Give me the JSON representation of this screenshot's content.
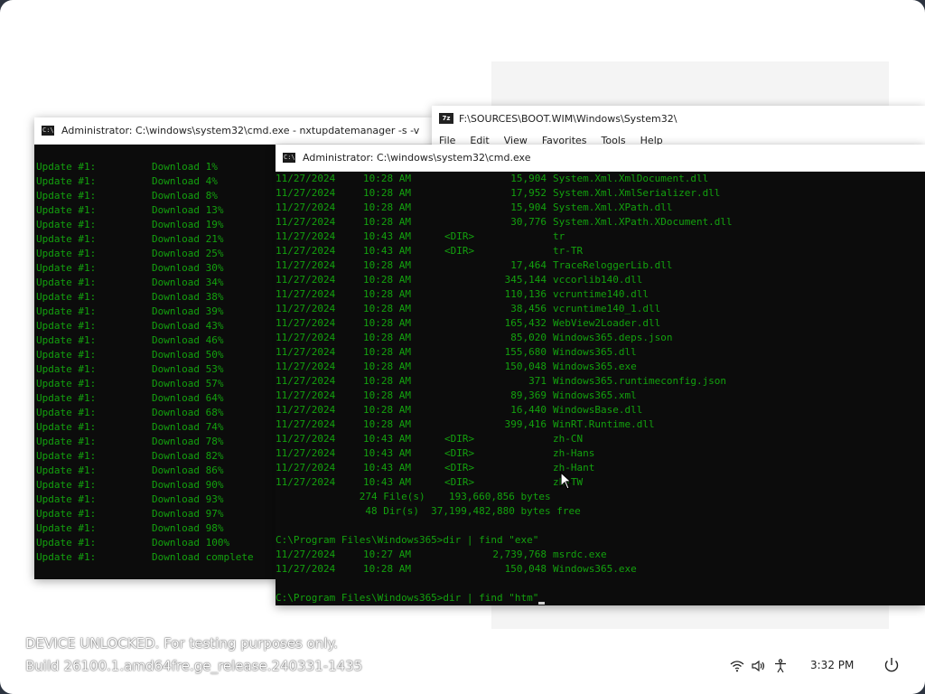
{
  "watermark": {
    "line1": "DEVICE UNLOCKED. For testing purposes only.",
    "line2": "Build 26100.1.amd64fre.ge_release.240331-1435"
  },
  "tray": {
    "icons": [
      "wifi-icon",
      "volume-icon",
      "accessibility-icon"
    ],
    "clock": "3:32 PM",
    "power_icon": "power-icon"
  },
  "window_update": {
    "title": "Administrator: C:\\windows\\system32\\cmd.exe - nxtupdatemanager  -s -v",
    "lines": [
      [
        "Update #1:",
        "Download 1%"
      ],
      [
        "Update #1:",
        "Download 4%"
      ],
      [
        "Update #1:",
        "Download 8%"
      ],
      [
        "Update #1:",
        "Download 13%"
      ],
      [
        "Update #1:",
        "Download 19%"
      ],
      [
        "Update #1:",
        "Download 21%"
      ],
      [
        "Update #1:",
        "Download 25%"
      ],
      [
        "Update #1:",
        "Download 30%"
      ],
      [
        "Update #1:",
        "Download 34%"
      ],
      [
        "Update #1:",
        "Download 38%"
      ],
      [
        "Update #1:",
        "Download 39%"
      ],
      [
        "Update #1:",
        "Download 43%"
      ],
      [
        "Update #1:",
        "Download 46%"
      ],
      [
        "Update #1:",
        "Download 50%"
      ],
      [
        "Update #1:",
        "Download 53%"
      ],
      [
        "Update #1:",
        "Download 57%"
      ],
      [
        "Update #1:",
        "Download 64%"
      ],
      [
        "Update #1:",
        "Download 68%"
      ],
      [
        "Update #1:",
        "Download 74%"
      ],
      [
        "Update #1:",
        "Download 78%"
      ],
      [
        "Update #1:",
        "Download 82%"
      ],
      [
        "Update #1:",
        "Download 86%"
      ],
      [
        "Update #1:",
        "Download 90%"
      ],
      [
        "Update #1:",
        "Download 93%"
      ],
      [
        "Update #1:",
        "Download 97%"
      ],
      [
        "Update #1:",
        "Download 98%"
      ],
      [
        "Update #1:",
        "Download 100%"
      ],
      [
        "Update #1:",
        "Download complete"
      ]
    ]
  },
  "window_7zip": {
    "title": "F:\\SOURCES\\BOOT.WIM\\Windows\\System32\\",
    "menu": [
      "File",
      "Edit",
      "View",
      "Favorites",
      "Tools",
      "Help"
    ]
  },
  "window_cmd": {
    "title": "Administrator: C:\\windows\\system32\\cmd.exe",
    "listing": [
      {
        "date": "11/27/2024",
        "time": "10:28 AM",
        "dir": "",
        "size": "15,904",
        "name": "System.Xml.XmlDocument.dll"
      },
      {
        "date": "11/27/2024",
        "time": "10:28 AM",
        "dir": "",
        "size": "17,952",
        "name": "System.Xml.XmlSerializer.dll"
      },
      {
        "date": "11/27/2024",
        "time": "10:28 AM",
        "dir": "",
        "size": "15,904",
        "name": "System.Xml.XPath.dll"
      },
      {
        "date": "11/27/2024",
        "time": "10:28 AM",
        "dir": "",
        "size": "30,776",
        "name": "System.Xml.XPath.XDocument.dll"
      },
      {
        "date": "11/27/2024",
        "time": "10:43 AM",
        "dir": "<DIR>",
        "size": "",
        "name": "tr"
      },
      {
        "date": "11/27/2024",
        "time": "10:43 AM",
        "dir": "<DIR>",
        "size": "",
        "name": "tr-TR"
      },
      {
        "date": "11/27/2024",
        "time": "10:28 AM",
        "dir": "",
        "size": "17,464",
        "name": "TraceReloggerLib.dll"
      },
      {
        "date": "11/27/2024",
        "time": "10:28 AM",
        "dir": "",
        "size": "345,144",
        "name": "vccorlib140.dll"
      },
      {
        "date": "11/27/2024",
        "time": "10:28 AM",
        "dir": "",
        "size": "110,136",
        "name": "vcruntime140.dll"
      },
      {
        "date": "11/27/2024",
        "time": "10:28 AM",
        "dir": "",
        "size": "38,456",
        "name": "vcruntime140_1.dll"
      },
      {
        "date": "11/27/2024",
        "time": "10:28 AM",
        "dir": "",
        "size": "165,432",
        "name": "WebView2Loader.dll"
      },
      {
        "date": "11/27/2024",
        "time": "10:28 AM",
        "dir": "",
        "size": "85,020",
        "name": "Windows365.deps.json"
      },
      {
        "date": "11/27/2024",
        "time": "10:28 AM",
        "dir": "",
        "size": "155,680",
        "name": "Windows365.dll"
      },
      {
        "date": "11/27/2024",
        "time": "10:28 AM",
        "dir": "",
        "size": "150,048",
        "name": "Windows365.exe"
      },
      {
        "date": "11/27/2024",
        "time": "10:28 AM",
        "dir": "",
        "size": "371",
        "name": "Windows365.runtimeconfig.json"
      },
      {
        "date": "11/27/2024",
        "time": "10:28 AM",
        "dir": "",
        "size": "89,369",
        "name": "Windows365.xml"
      },
      {
        "date": "11/27/2024",
        "time": "10:28 AM",
        "dir": "",
        "size": "16,440",
        "name": "WindowsBase.dll"
      },
      {
        "date": "11/27/2024",
        "time": "10:28 AM",
        "dir": "",
        "size": "399,416",
        "name": "WinRT.Runtime.dll"
      },
      {
        "date": "11/27/2024",
        "time": "10:43 AM",
        "dir": "<DIR>",
        "size": "",
        "name": "zh-CN"
      },
      {
        "date": "11/27/2024",
        "time": "10:43 AM",
        "dir": "<DIR>",
        "size": "",
        "name": "zh-Hans"
      },
      {
        "date": "11/27/2024",
        "time": "10:43 AM",
        "dir": "<DIR>",
        "size": "",
        "name": "zh-Hant"
      },
      {
        "date": "11/27/2024",
        "time": "10:43 AM",
        "dir": "<DIR>",
        "size": "",
        "name": "zh-TW"
      }
    ],
    "summary_files": "              274 File(s)    193,660,856 bytes",
    "summary_dirs": "               48 Dir(s)  37,199,482,880 bytes free",
    "prompt1": "C:\\Program Files\\Windows365>dir | find \"exe\"",
    "find_results": [
      {
        "date": "11/27/2024",
        "time": "10:27 AM",
        "size": "2,739,768",
        "name": "msrdc.exe"
      },
      {
        "date": "11/27/2024",
        "time": "10:28 AM",
        "size": "150,048",
        "name": "Windows365.exe"
      }
    ],
    "prompt2": "C:\\Program Files\\Windows365>dir | find \"htm\""
  }
}
